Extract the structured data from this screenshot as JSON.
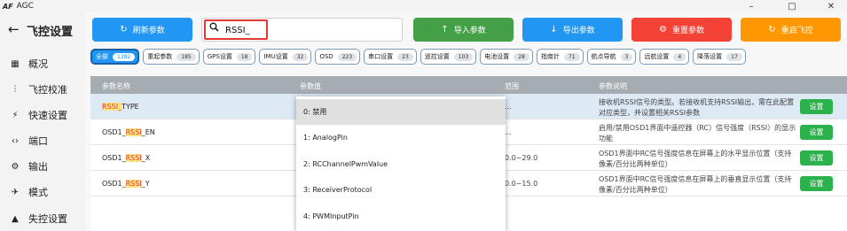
{
  "window": {
    "logo": "AF",
    "title": "AGC",
    "controls": {
      "minimize": "–",
      "maximize": "□",
      "close": "✕"
    }
  },
  "sidebar": {
    "back_icon": "←",
    "title": "飞控设置",
    "items": [
      {
        "icon": "grid-icon",
        "glyph": "▦",
        "label": "概况"
      },
      {
        "icon": "sliders-icon",
        "glyph": "⫶",
        "label": "飞控校准"
      },
      {
        "icon": "bolt-icon",
        "glyph": "⚡",
        "label": "快速设置"
      },
      {
        "icon": "ports-icon",
        "glyph": "‹›",
        "label": "端口"
      },
      {
        "icon": "gear-icon",
        "glyph": "⚙",
        "label": "输出"
      },
      {
        "icon": "plane-icon",
        "glyph": "✈",
        "label": "模式"
      },
      {
        "icon": "warning-icon",
        "glyph": "▲",
        "label": "失控设置"
      }
    ]
  },
  "toolbar": {
    "refresh": {
      "icon": "refresh-icon",
      "glyph": "↻",
      "label": "刷新参数",
      "color": "#2196f3"
    },
    "search": {
      "icon": "search-icon",
      "glyph": "🔍",
      "value": "RSSI_"
    },
    "import": {
      "icon": "arrow-up-icon",
      "glyph": "↑",
      "label": "导入参数",
      "color": "#43a047"
    },
    "export": {
      "icon": "arrow-down-icon",
      "glyph": "↓",
      "label": "导出参数",
      "color": "#2196f3"
    },
    "reset": {
      "icon": "settings-icon",
      "glyph": "⚙",
      "label": "重置参数",
      "color": "#f44336"
    },
    "reboot": {
      "icon": "restart-icon",
      "glyph": "↻",
      "label": "重启飞控",
      "color": "#ff9800"
    }
  },
  "filters": [
    {
      "label": "全部",
      "count": "1282",
      "active": true
    },
    {
      "label": "重起参数",
      "count": "185"
    },
    {
      "label": "GPS设置",
      "count": "18"
    },
    {
      "label": "IMU设置",
      "count": "32"
    },
    {
      "label": "OSD",
      "count": "223"
    },
    {
      "label": "串口设置",
      "count": "23"
    },
    {
      "label": "遥控设置",
      "count": "103"
    },
    {
      "label": "电池设置",
      "count": "28"
    },
    {
      "label": "指南针",
      "count": "71"
    },
    {
      "label": "航点导航",
      "count": "3"
    },
    {
      "label": "远航设置",
      "count": "4"
    },
    {
      "label": "降落设置",
      "count": "17"
    }
  ],
  "table": {
    "headers": {
      "name": "参数名称",
      "value": "参数值",
      "range": "范围",
      "desc": "参数说明"
    },
    "rows": [
      {
        "name_hl": "RSSI_",
        "name_pre": "",
        "name_post": "TYPE",
        "range": "...",
        "desc": "接收机RSSI信号的类型。若接收机支持RSSI输出，需在此配置对应类型，并设置相关RSSI参数",
        "action": "设置"
      },
      {
        "name_pre": "OSD1_",
        "name_hl": "RSSI",
        "name_post": "_EN",
        "range": "...",
        "desc": "启用/禁用OSD1界面中遥控器（RC）信号强度（RSSI）的显示功能",
        "action": "设置"
      },
      {
        "name_pre": "OSD1_",
        "name_hl": "RSSI",
        "name_post": "_X",
        "range": "0.0~29.0",
        "desc": "OSD1界面中RC信号强度信息在屏幕上的水平显示位置（支持像素/百分比两种单位）",
        "action": "设置"
      },
      {
        "name_pre": "OSD1_",
        "name_hl": "RSSI",
        "name_post": "_Y",
        "range": "0.0~15.0",
        "desc": "OSD1界面中RC信号强度信息在屏幕上的垂直显示位置（支持像素/百分比两种单位）",
        "action": "设置"
      }
    ]
  },
  "dropdown": {
    "options": [
      "0: 禁用",
      "1: AnalogPin",
      "2: RCChannelPwmValue",
      "3: ReceiverProtocol",
      "4: PWMInputPin"
    ],
    "selected_index": 0
  }
}
